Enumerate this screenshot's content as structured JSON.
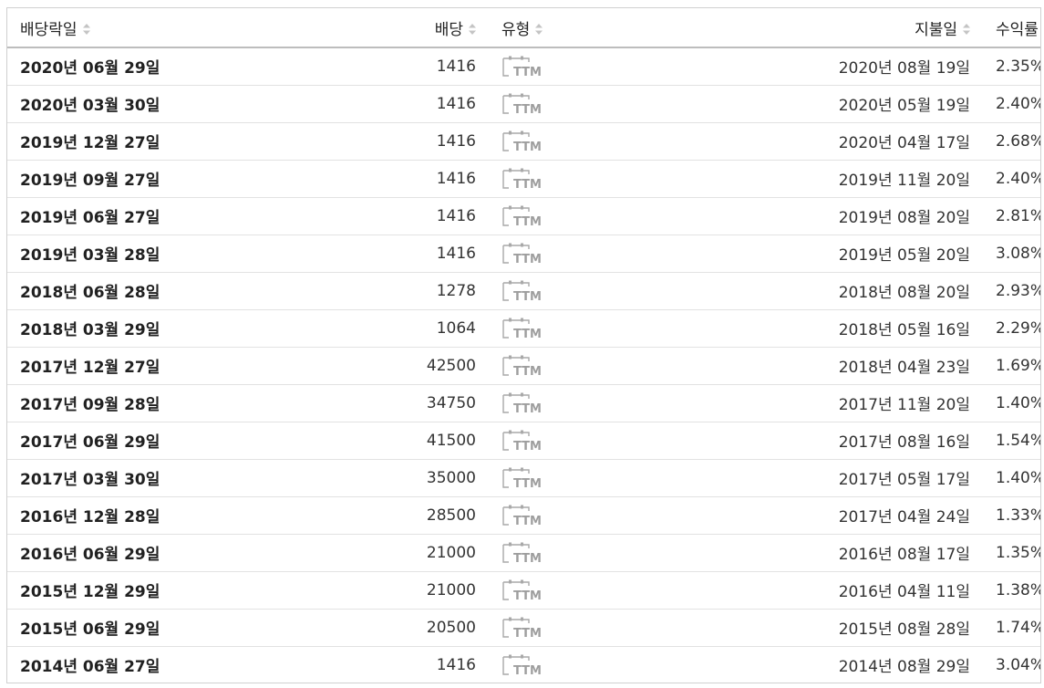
{
  "columns": {
    "ex_date": "배당락일",
    "dividend": "배당",
    "type": "유형",
    "pay_date": "지불일",
    "yield": "수익률"
  },
  "type_badge": "TTM",
  "colors": {
    "border": "#d0d0d0",
    "row_divider": "#e2e2e2",
    "header_divider": "#bdbdbd",
    "icon_gray": "#9e9e9e"
  },
  "rows": [
    {
      "ex_date": "2020년 06월 29일",
      "dividend": "1416",
      "pay_date": "2020년 08월 19일",
      "yield": "2.35%"
    },
    {
      "ex_date": "2020년 03월 30일",
      "dividend": "1416",
      "pay_date": "2020년 05월 19일",
      "yield": "2.40%"
    },
    {
      "ex_date": "2019년 12월 27일",
      "dividend": "1416",
      "pay_date": "2020년 04월 17일",
      "yield": "2.68%"
    },
    {
      "ex_date": "2019년 09월 27일",
      "dividend": "1416",
      "pay_date": "2019년 11월 20일",
      "yield": "2.40%"
    },
    {
      "ex_date": "2019년 06월 27일",
      "dividend": "1416",
      "pay_date": "2019년 08월 20일",
      "yield": "2.81%"
    },
    {
      "ex_date": "2019년 03월 28일",
      "dividend": "1416",
      "pay_date": "2019년 05월 20일",
      "yield": "3.08%"
    },
    {
      "ex_date": "2018년 06월 28일",
      "dividend": "1278",
      "pay_date": "2018년 08월 20일",
      "yield": "2.93%"
    },
    {
      "ex_date": "2018년 03월 29일",
      "dividend": "1064",
      "pay_date": "2018년 05월 16일",
      "yield": "2.29%"
    },
    {
      "ex_date": "2017년 12월 27일",
      "dividend": "42500",
      "pay_date": "2018년 04월 23일",
      "yield": "1.69%"
    },
    {
      "ex_date": "2017년 09월 28일",
      "dividend": "34750",
      "pay_date": "2017년 11월 20일",
      "yield": "1.40%"
    },
    {
      "ex_date": "2017년 06월 29일",
      "dividend": "41500",
      "pay_date": "2017년 08월 16일",
      "yield": "1.54%"
    },
    {
      "ex_date": "2017년 03월 30일",
      "dividend": "35000",
      "pay_date": "2017년 05월 17일",
      "yield": "1.40%"
    },
    {
      "ex_date": "2016년 12월 28일",
      "dividend": "28500",
      "pay_date": "2017년 04월 24일",
      "yield": "1.33%"
    },
    {
      "ex_date": "2016년 06월 29일",
      "dividend": "21000",
      "pay_date": "2016년 08월 17일",
      "yield": "1.35%"
    },
    {
      "ex_date": "2015년 12월 29일",
      "dividend": "21000",
      "pay_date": "2016년 04월 11일",
      "yield": "1.38%"
    },
    {
      "ex_date": "2015년 06월 29일",
      "dividend": "20500",
      "pay_date": "2015년 08월 28일",
      "yield": "1.74%"
    },
    {
      "ex_date": "2014년 06월 27일",
      "dividend": "1416",
      "pay_date": "2014년 08월 29일",
      "yield": "3.04%"
    }
  ]
}
